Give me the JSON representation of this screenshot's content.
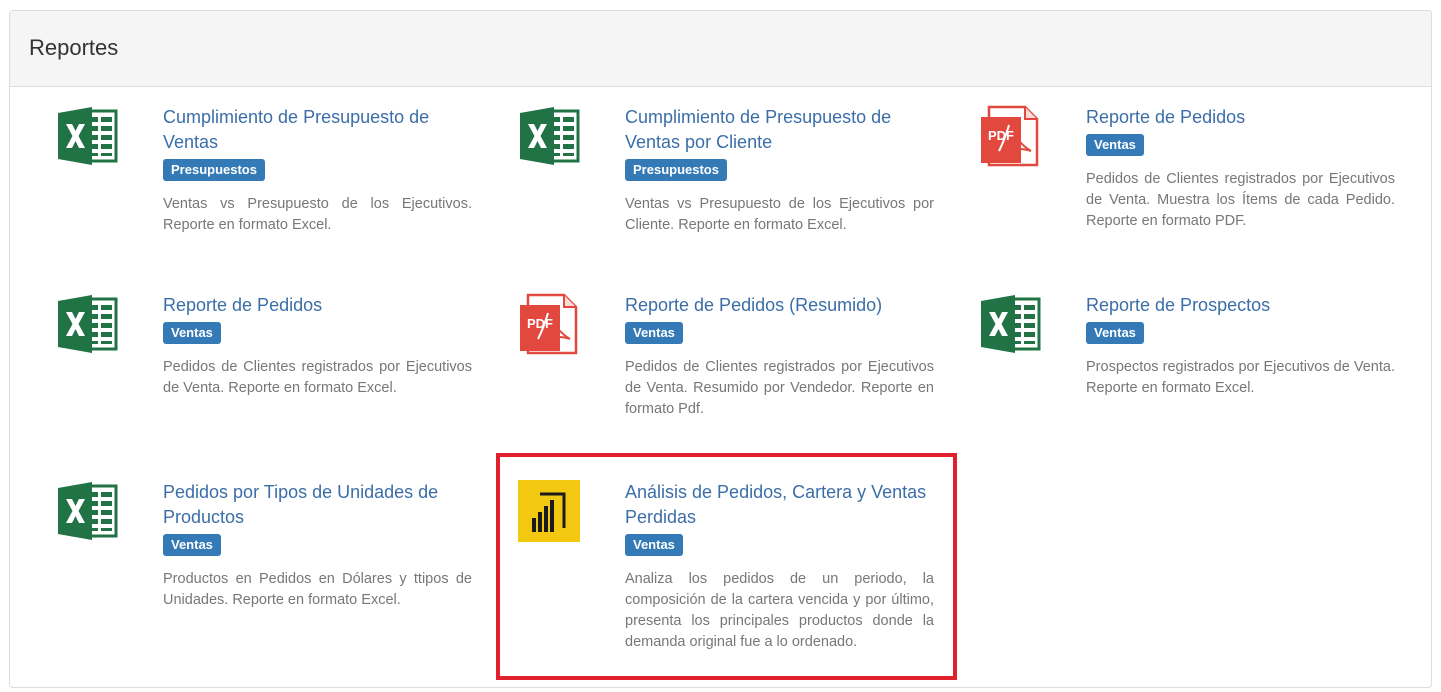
{
  "panel": {
    "title": "Reportes"
  },
  "colors": {
    "link": "#3b6ea8",
    "badge": "#337ab7",
    "excel": "#217346",
    "pdf": "#e2483e",
    "powerbi": "#f2c811",
    "highlight": "#e0202a"
  },
  "reports": [
    {
      "title": "Cumplimiento de Presupuesto de Ventas",
      "badge": "Presupuestos",
      "description": "Ventas vs Presupuesto de los Ejecutivos. Reporte en formato Excel.",
      "icon": "excel-icon"
    },
    {
      "title": "Cumplimiento de Presupuesto de Ventas por Cliente",
      "badge": "Presupuestos",
      "description": "Ventas vs Presupuesto de los Ejecutivos por Cliente. Reporte en formato Excel.",
      "icon": "excel-icon"
    },
    {
      "title": "Reporte de Pedidos",
      "badge": "Ventas",
      "description": "Pedidos de Clientes registrados por Ejecutivos de Venta. Muestra los Ítems de cada Pedido. Reporte en formato PDF.",
      "icon": "pdf-icon"
    },
    {
      "title": "Reporte de Pedidos",
      "badge": "Ventas",
      "description": "Pedidos de Clientes registrados por Ejecutivos de Venta. Reporte en formato Excel.",
      "icon": "excel-icon"
    },
    {
      "title": "Reporte de Pedidos (Resumido)",
      "badge": "Ventas",
      "description": "Pedidos de Clientes registrados por Ejecutivos de Venta. Resumido por Vendedor. Reporte en formato Pdf.",
      "icon": "pdf-icon"
    },
    {
      "title": "Reporte de Prospectos",
      "badge": "Ventas",
      "description": "Prospectos registrados por Ejecutivos de Venta. Reporte en formato Excel.",
      "icon": "excel-icon"
    },
    {
      "title": "Pedidos por Tipos de Unidades de Productos",
      "badge": "Ventas",
      "description": "Productos en Pedidos en Dólares y ttipos de Unidades. Reporte en formato Excel.",
      "icon": "excel-icon"
    },
    {
      "title": "Análisis de Pedidos, Cartera y Ventas Perdidas",
      "badge": "Ventas",
      "description": "Analiza los pedidos de un periodo, la composición de la cartera vencida y por último, presenta los principales productos donde la demanda original fue a lo ordenado.",
      "icon": "powerbi-icon"
    }
  ]
}
